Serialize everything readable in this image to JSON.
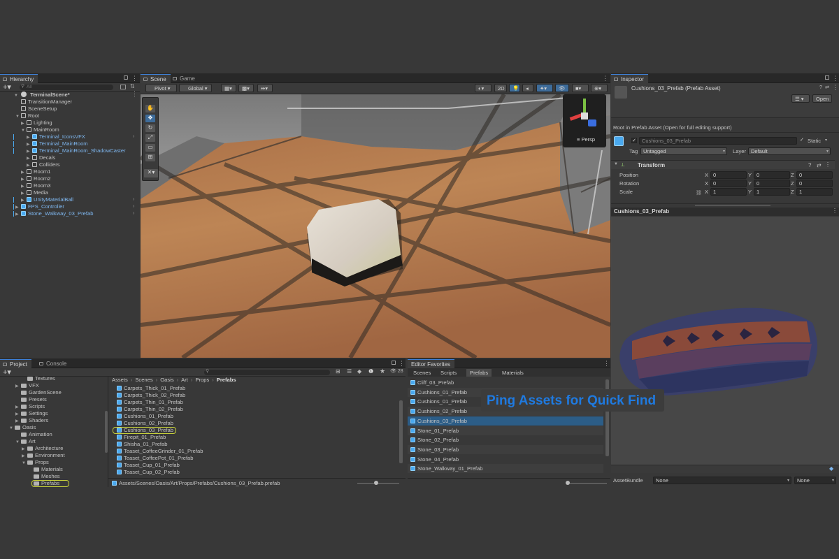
{
  "hierarchy": {
    "tab": "Hierarchy",
    "search_placeholder": "All",
    "scene": "TerminalScene*",
    "items": [
      {
        "label": "TransitionManager",
        "depth": 1,
        "icon": "cube",
        "blue": false
      },
      {
        "label": "SceneSetup",
        "depth": 1,
        "icon": "cube",
        "blue": false
      },
      {
        "label": "Root",
        "depth": 1,
        "icon": "cube",
        "blue": false,
        "arrow": "▼"
      },
      {
        "label": "Lighting",
        "depth": 2,
        "icon": "cube",
        "blue": false,
        "arrow": "▶"
      },
      {
        "label": "MainRoom",
        "depth": 2,
        "icon": "cube",
        "blue": false,
        "arrow": "▼"
      },
      {
        "label": "Terminal_IconsVFX",
        "depth": 3,
        "icon": "prefab",
        "blue": true,
        "arrow": "▶",
        "more": true
      },
      {
        "label": "Terminal_MainRoom",
        "depth": 3,
        "icon": "prefab",
        "blue": true,
        "arrow": "▶"
      },
      {
        "label": "Terminal_MainRoom_ShadowCaster",
        "depth": 3,
        "icon": "prefab",
        "blue": true,
        "arrow": "▶"
      },
      {
        "label": "Decals",
        "depth": 3,
        "icon": "cube",
        "blue": false,
        "arrow": "▶"
      },
      {
        "label": "Colliders",
        "depth": 3,
        "icon": "cube",
        "blue": false,
        "arrow": "▶"
      },
      {
        "label": "Room1",
        "depth": 2,
        "icon": "cube",
        "blue": false,
        "arrow": "▶"
      },
      {
        "label": "Room2",
        "depth": 2,
        "icon": "cube",
        "blue": false,
        "arrow": "▶"
      },
      {
        "label": "Room3",
        "depth": 2,
        "icon": "cube",
        "blue": false,
        "arrow": "▶"
      },
      {
        "label": "Media",
        "depth": 2,
        "icon": "cube",
        "blue": false,
        "arrow": "▶"
      },
      {
        "label": "UnityMaterialBall",
        "depth": 2,
        "icon": "prefab",
        "blue": true,
        "arrow": "▶",
        "more": true
      },
      {
        "label": "FPS_Controller",
        "depth": 1,
        "icon": "prefab",
        "blue": true,
        "arrow": "▶",
        "more": true
      },
      {
        "label": "Stone_Walkway_03_Prefab",
        "depth": 1,
        "icon": "prefab",
        "blue": true,
        "arrow": "▶",
        "more": true
      }
    ]
  },
  "scene_view": {
    "tabs": [
      "Scene",
      "Game"
    ],
    "pivot": "Pivot",
    "global": "Global",
    "mode_2d": "2D",
    "persp": "Persp"
  },
  "project": {
    "tabs": [
      "Project",
      "Console"
    ],
    "hidden_count": "28",
    "folders": [
      {
        "label": "Textures",
        "depth": 3
      },
      {
        "label": "VFX",
        "depth": 2,
        "arrow": "▶"
      },
      {
        "label": "GardenScene",
        "depth": 2
      },
      {
        "label": "Presets",
        "depth": 2
      },
      {
        "label": "Scripts",
        "depth": 2,
        "arrow": "▶"
      },
      {
        "label": "Settings",
        "depth": 2,
        "arrow": "▶"
      },
      {
        "label": "Shaders",
        "depth": 2,
        "arrow": "▶"
      },
      {
        "label": "Oasis",
        "depth": 1,
        "arrow": "▼"
      },
      {
        "label": "Animation",
        "depth": 2
      },
      {
        "label": "Art",
        "depth": 2,
        "arrow": "▼"
      },
      {
        "label": "Architecture",
        "depth": 3,
        "arrow": "▶"
      },
      {
        "label": "Environment",
        "depth": 3,
        "arrow": "▶"
      },
      {
        "label": "Props",
        "depth": 3,
        "arrow": "▼"
      },
      {
        "label": "Materials",
        "depth": 4
      },
      {
        "label": "Meshes",
        "depth": 4
      },
      {
        "label": "Prefabs",
        "depth": 4,
        "selected": true
      }
    ],
    "breadcrumb": [
      "Assets",
      "Scenes",
      "Oasis",
      "Art",
      "Props",
      "Prefabs"
    ],
    "assets": [
      {
        "label": "Carpets_Thick_01_Prefab"
      },
      {
        "label": "Carpets_Thick_02_Prefab"
      },
      {
        "label": "Carpets_Thin_01_Prefab"
      },
      {
        "label": "Carpets_Thin_02_Prefab"
      },
      {
        "label": "Cushions_01_Prefab"
      },
      {
        "label": "Cushions_02_Prefab"
      },
      {
        "label": "Cushions_03_Prefab",
        "selected": true
      },
      {
        "label": "Firepit_01_Prefab"
      },
      {
        "label": "Shisha_01_Prefab"
      },
      {
        "label": "Teaset_CoffeeGrinder_01_Prefab"
      },
      {
        "label": "Teaset_CoffeePot_01_Prefab"
      },
      {
        "label": "Teaset_Cup_01_Prefab"
      },
      {
        "label": "Teaset_Cup_02_Prefab"
      }
    ],
    "path": "Assets/Scenes/Oasis/Art/Props/Prefabs/Cushions_03_Prefab.prefab"
  },
  "favorites": {
    "tab": "Editor Favorites",
    "subtabs": [
      "Scenes",
      "Scripts",
      "Prefabs",
      "Materials"
    ],
    "active_subtab": 2,
    "items": [
      {
        "label": "Cliff_03_Prefab"
      },
      {
        "label": "Cushions_01_Prefab"
      },
      {
        "label": "Cushions_01_Prefab"
      },
      {
        "label": "Cushions_02_Prefab"
      },
      {
        "label": "Cushions_03_Prefab",
        "selected": true
      },
      {
        "label": "Stone_01_Prefab"
      },
      {
        "label": "Stone_02_Prefab"
      },
      {
        "label": "Stone_03_Prefab"
      },
      {
        "label": "Stone_04_Prefab"
      },
      {
        "label": "Stone_Walkway_01_Prefab"
      }
    ]
  },
  "inspector": {
    "tab": "Inspector",
    "asset_title": "Cushions_03_Prefab (Prefab Asset)",
    "open_button": "Open",
    "root_note": "Root in Prefab Asset (Open for full editing support)",
    "object_name": "Cushions_03_Prefab",
    "static_label": "Static",
    "tag_label": "Tag",
    "tag_value": "Untagged",
    "layer_label": "Layer",
    "layer_value": "Default",
    "transform_title": "Transform",
    "transform": [
      {
        "label": "Position",
        "x": "0",
        "y": "0",
        "z": "0"
      },
      {
        "label": "Rotation",
        "x": "0",
        "y": "0",
        "z": "0"
      },
      {
        "label": "Scale",
        "x": "1",
        "y": "1",
        "z": "1"
      }
    ],
    "axis": {
      "x": "X",
      "y": "Y",
      "z": "Z"
    },
    "preview_title": "Cushions_03_Prefab",
    "assetbundle_label": "AssetBundle",
    "assetbundle_value": "None",
    "variant_value": "None"
  },
  "overlay_caption": "Ping Assets for Quick Find",
  "colors": {
    "accent": "#3d7fd6",
    "selection": "#2c5d87",
    "prefab_blue": "#4aa9ef",
    "caption": "#1f7ae0",
    "highlight_ring": "#c8d23a"
  }
}
